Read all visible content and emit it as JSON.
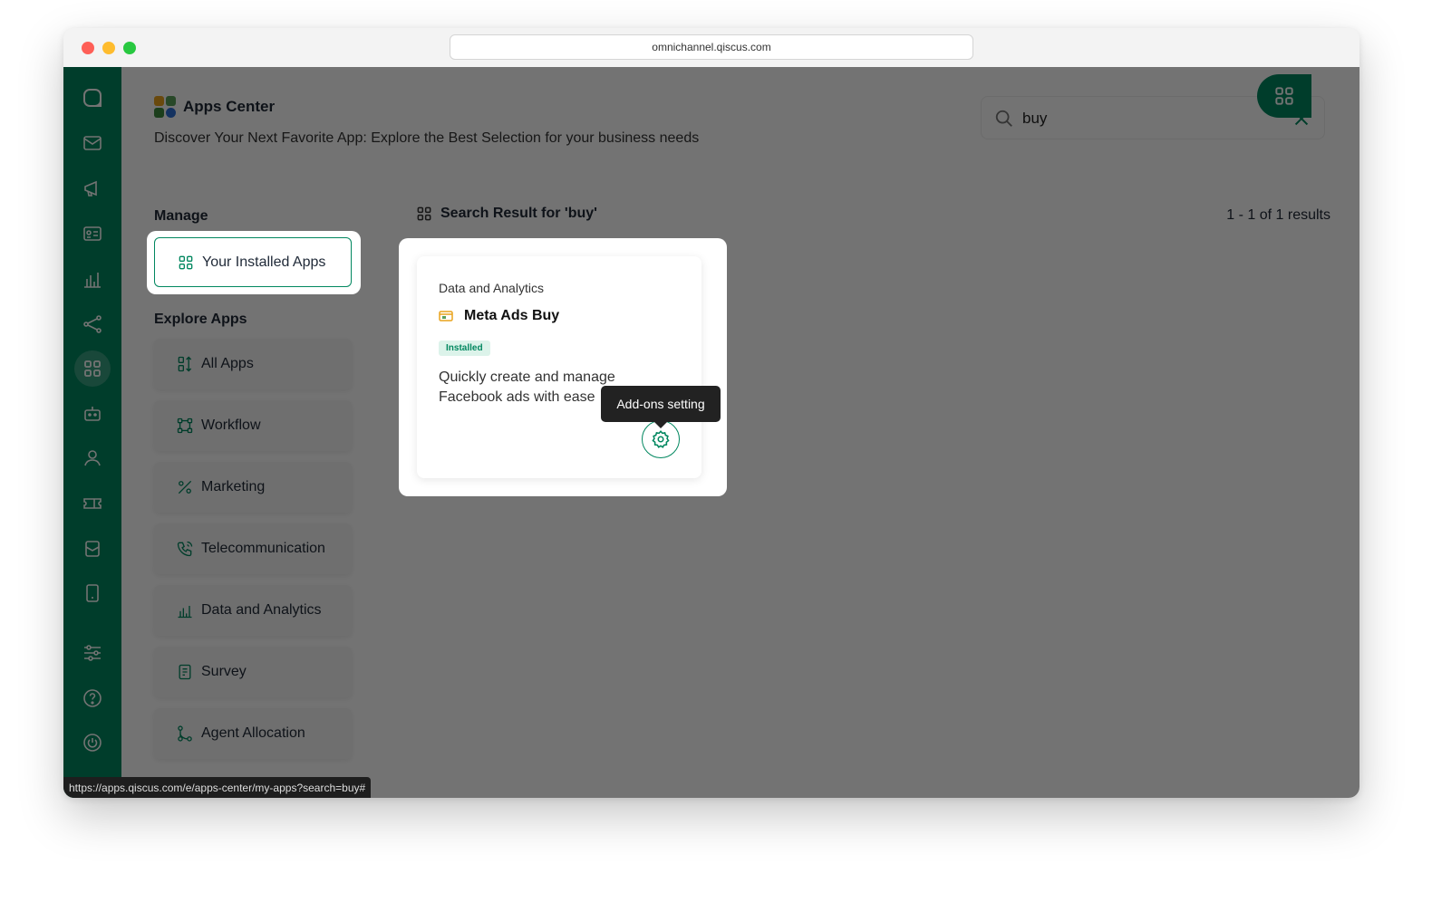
{
  "browser": {
    "url": "omnichannel.qiscus.com"
  },
  "header": {
    "title": "Apps Center",
    "subtitle": "Discover Your Next Favorite App: Explore the Best Selection for your business needs"
  },
  "search": {
    "value": "buy"
  },
  "sidebar": {
    "icons": [
      "chat-logo-icon",
      "inbox-icon",
      "broadcast-icon",
      "contact-card-icon",
      "analytics-icon",
      "integration-icon",
      "apps-icon",
      "bot-icon",
      "agent-icon",
      "ticket-icon",
      "mailbox-icon",
      "mobile-icon",
      "settings-sliders-icon",
      "help-icon",
      "power-icon"
    ],
    "active": "apps-icon"
  },
  "manage": {
    "label": "Manage",
    "installed_label": "Your Installed Apps"
  },
  "explore": {
    "label": "Explore Apps",
    "items": [
      {
        "label": "All Apps",
        "icon": "sort-icon"
      },
      {
        "label": "Workflow",
        "icon": "workflow-icon"
      },
      {
        "label": "Marketing",
        "icon": "marketing-icon"
      },
      {
        "label": "Telecommunication",
        "icon": "phone-icon"
      },
      {
        "label": "Data and Analytics",
        "icon": "chart-icon"
      },
      {
        "label": "Survey",
        "icon": "survey-icon"
      },
      {
        "label": "Agent Allocation",
        "icon": "allocation-icon"
      }
    ]
  },
  "results": {
    "heading": "Search Result for 'buy'",
    "count": "1 - 1 of 1 results"
  },
  "card": {
    "category": "Data and Analytics",
    "name": "Meta Ads Buy",
    "badge": "Installed",
    "description": "Quickly create and manage Facebook ads with ease",
    "tooltip": "Add-ons setting"
  },
  "status_url": "https://apps.qiscus.com/e/apps-center/my-apps?search=buy#",
  "colors": {
    "primary": "#01875f",
    "badge_bg": "#dcf3ea"
  }
}
